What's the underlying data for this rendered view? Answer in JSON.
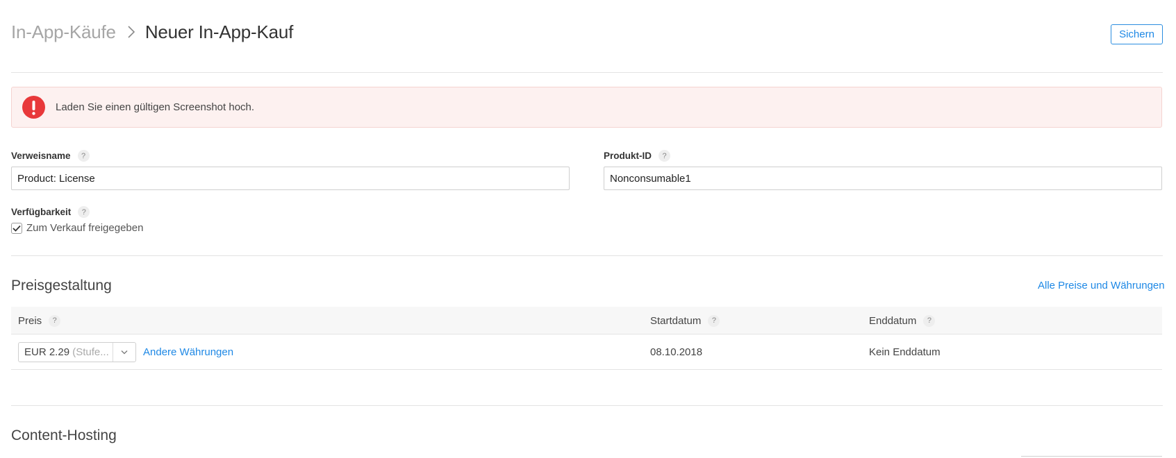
{
  "header": {
    "breadcrumb_parent": "In-App-Käufe",
    "breadcrumb_current": "Neuer In-App-Kauf",
    "save_label": "Sichern"
  },
  "error": {
    "message": "Laden Sie einen gültigen Screenshot hoch.",
    "icon": "exclamation-icon",
    "color": "#e8383a"
  },
  "form": {
    "reference_name": {
      "label": "Verweisname",
      "value": "Product: License"
    },
    "product_id": {
      "label": "Produkt-ID",
      "value": "Nonconsumable1"
    },
    "availability": {
      "label": "Verfügbarkeit",
      "checkbox_label": "Zum Verkauf freigegeben",
      "checked": true
    },
    "help_glyph": "?"
  },
  "pricing": {
    "title": "Preisgestaltung",
    "all_prices_link": "Alle Preise und Währungen",
    "columns": {
      "price": "Preis",
      "start": "Startdatum",
      "end": "Enddatum"
    },
    "row": {
      "price_value": "EUR 2.29",
      "price_tier": "(Stufe...",
      "other_currencies": "Andere Währungen",
      "start_date": "08.10.2018",
      "end_date": "Kein Enddatum"
    }
  },
  "content_hosting": {
    "title": "Content-Hosting"
  },
  "colors": {
    "accent": "#1e88e5",
    "error_bg": "#fdf1f0"
  }
}
